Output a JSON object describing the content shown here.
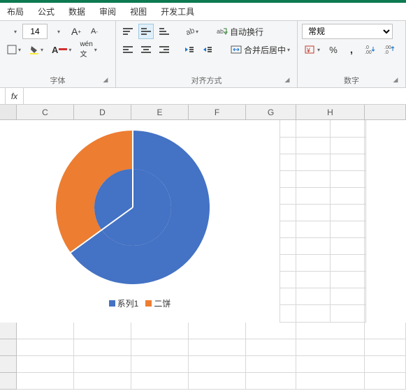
{
  "tabs": {
    "layout": "布局",
    "formula": "公式",
    "data": "数据",
    "review": "审阅",
    "view": "视图",
    "dev": "开发工具"
  },
  "font": {
    "size": "14",
    "grow": "A",
    "shrink": "A"
  },
  "groups": {
    "font": "字体",
    "align": "对齐方式",
    "number": "数字"
  },
  "align": {
    "wrap": "自动换行",
    "merge": "合并后居中"
  },
  "number": {
    "format": "常规",
    "pct": "%",
    "comma": ","
  },
  "fx": "fx",
  "cols": {
    "C": "C",
    "D": "D",
    "E": "E",
    "F": "F",
    "G": "G",
    "H": "H"
  },
  "legend": {
    "s1": "系列1",
    "s2": "二饼"
  },
  "colors": {
    "blue": "#4472c4",
    "orange": "#ed7d31"
  },
  "chart_data": {
    "type": "pie",
    "title": "",
    "legend_position": "bottom",
    "series": [
      {
        "name": "系列1",
        "color": "#4472c4",
        "value": 65
      },
      {
        "name": "二饼",
        "color": "#ed7d31",
        "value": 35
      }
    ],
    "note": "Sunburst-style: inner ring single blue segment; outer ring approx 65% blue / 35% orange starting at 12 o'clock clockwise."
  }
}
